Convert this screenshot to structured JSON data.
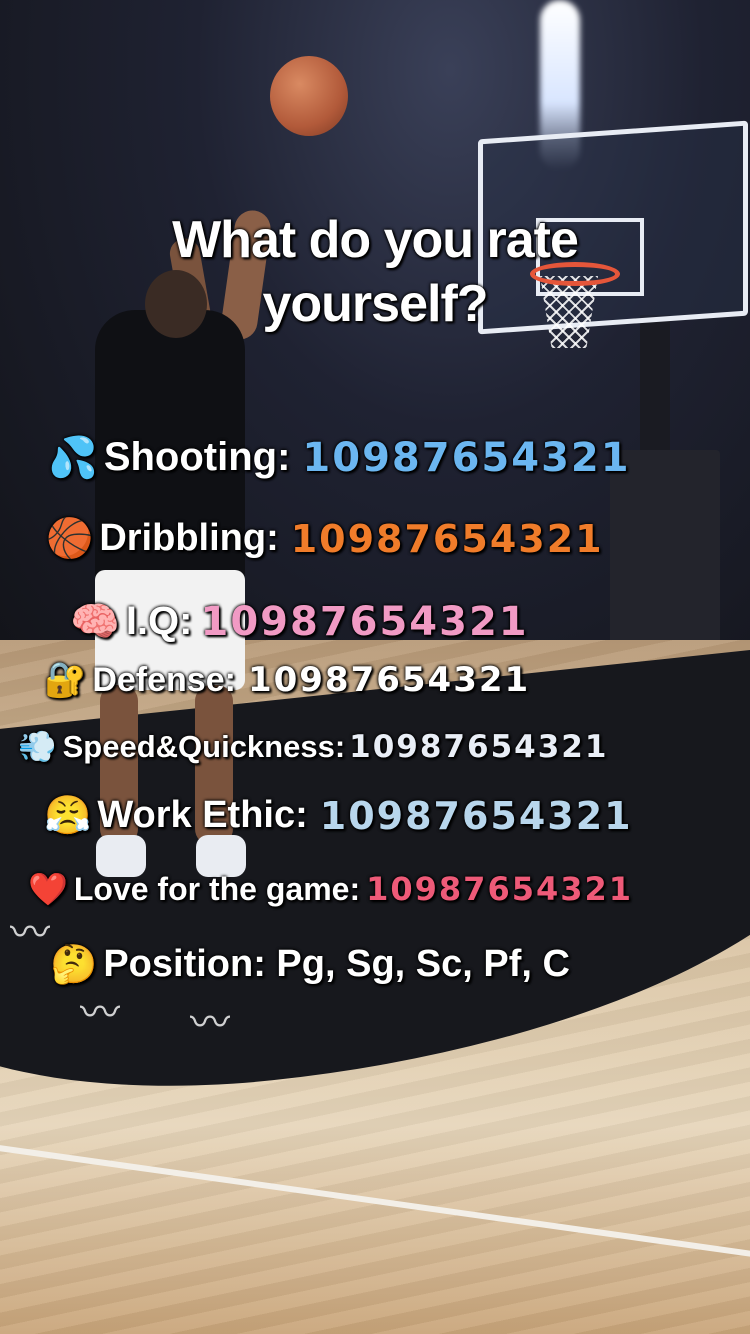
{
  "title": "What do you rate yourself?",
  "rows": [
    {
      "emoji": "💦",
      "label": "Shooting:",
      "numbers": "10987654321",
      "color": "#6bb6f0"
    },
    {
      "emoji": "🏀",
      "label": "Dribbling:",
      "numbers": "10987654321",
      "color": "#f07c2a"
    },
    {
      "emoji": "🧠",
      "label": "I.Q:",
      "numbers": "10987654321",
      "color": "#f19ac4"
    },
    {
      "emoji": "🔐",
      "label": "Defense:",
      "numbers": "10987654321",
      "color": "#ffffff"
    },
    {
      "emoji": "💨",
      "label": "Speed&Quickness:",
      "numbers": "10987654321",
      "color": "#e9eef6"
    },
    {
      "emoji": "😤",
      "label": "Work Ethic:",
      "numbers": "10987654321",
      "color": "#b8d6ec"
    },
    {
      "emoji": "❤️",
      "label": "Love for the game:",
      "numbers": "10987654321",
      "color": "#ee5a78"
    }
  ],
  "position": {
    "emoji": "🤔",
    "label": "Position: Pg, Sg, Sc, Pf, C"
  }
}
